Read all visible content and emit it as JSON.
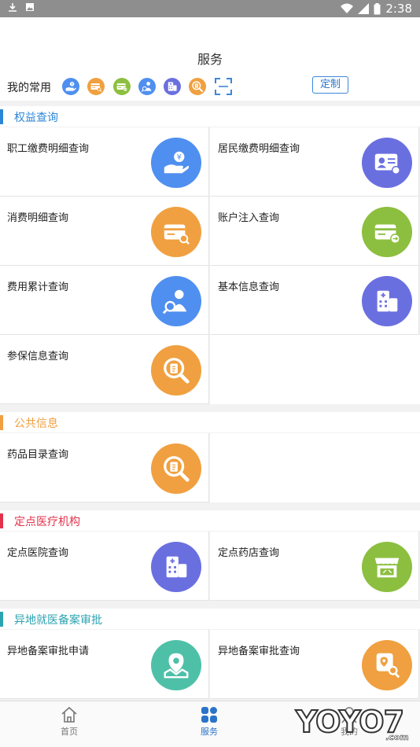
{
  "status_bar": {
    "time": "2:38"
  },
  "header": {
    "title": "服务"
  },
  "common": {
    "label": "我的常用",
    "custom_button": "定制",
    "quick_icons": [
      {
        "name": "hand-coin-icon",
        "color": "#4f8ff0"
      },
      {
        "name": "card-search-icon",
        "color": "#f0a040"
      },
      {
        "name": "card-transfer-icon",
        "color": "#8cbf3f"
      },
      {
        "name": "person-search-icon",
        "color": "#4f8ff0"
      },
      {
        "name": "building-icon",
        "color": "#6a6fe0"
      },
      {
        "name": "magnifier-doc-icon",
        "color": "#f0a040"
      }
    ]
  },
  "sections": [
    {
      "title": "权益查询",
      "accent": "#2d86d8",
      "items": [
        {
          "label": "职工缴费明细查询",
          "icon": "hand-coin-icon",
          "color": "#4f8ff0"
        },
        {
          "label": "居民缴费明细查询",
          "icon": "id-card-icon",
          "color": "#6a6fe0"
        },
        {
          "label": "消费明细查询",
          "icon": "card-search-icon",
          "color": "#f0a040"
        },
        {
          "label": "账户注入查询",
          "icon": "card-transfer-icon",
          "color": "#8cbf3f"
        },
        {
          "label": "费用累计查询",
          "icon": "person-search-icon",
          "color": "#4f8ff0"
        },
        {
          "label": "基本信息查询",
          "icon": "building-icon",
          "color": "#6a6fe0"
        },
        {
          "label": "参保信息查询",
          "icon": "magnifier-doc-icon",
          "color": "#f0a040"
        }
      ]
    },
    {
      "title": "公共信息",
      "accent": "#f0a040",
      "items": [
        {
          "label": "药品目录查询",
          "icon": "magnifier-doc-icon",
          "color": "#f0a040"
        }
      ]
    },
    {
      "title": "定点医疗机构",
      "accent": "#e2324b",
      "items": [
        {
          "label": "定点医院查询",
          "icon": "hospital-icon",
          "color": "#6a6fe0"
        },
        {
          "label": "定点药店查询",
          "icon": "pharmacy-store-icon",
          "color": "#8cbf3f"
        }
      ]
    },
    {
      "title": "异地就医备案审批",
      "accent": "#2ba3b0",
      "items": [
        {
          "label": "异地备案审批申请",
          "icon": "map-location-icon",
          "color": "#4fc0a8"
        },
        {
          "label": "异地备案审批查询",
          "icon": "map-search-icon",
          "color": "#f0a040"
        }
      ]
    }
  ],
  "bottom_nav": [
    {
      "label": "首页",
      "icon": "home-icon",
      "active": false
    },
    {
      "label": "服务",
      "icon": "grid-icon",
      "active": true
    },
    {
      "label": "我的",
      "icon": "person-icon",
      "active": false
    }
  ],
  "watermark": {
    "text": "YOYO7",
    "suffix": ".com"
  }
}
